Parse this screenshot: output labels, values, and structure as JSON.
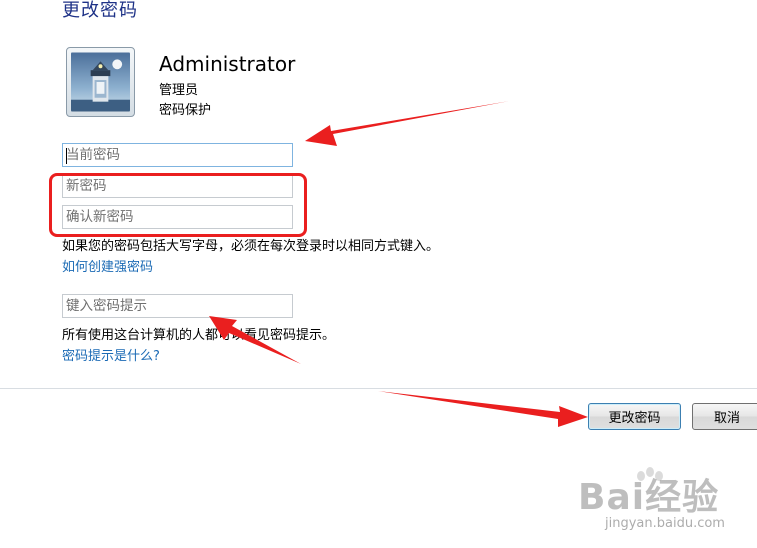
{
  "dialog": {
    "title": "更改密码"
  },
  "account": {
    "name": "Administrator",
    "role": "管理员",
    "protection": "密码保护"
  },
  "fields": {
    "current_password_placeholder": "当前密码",
    "new_password_placeholder": "新密码",
    "confirm_password_placeholder": "确认新密码",
    "hint_placeholder": "键入密码提示"
  },
  "notes": {
    "case_warning": "如果您的密码包括大写字母，必须在每次登录时以相同方式键入。",
    "strong_password_link": "如何创建强密码",
    "hint_visibility": "所有使用这台计算机的人都可以看见密码提示。",
    "hint_help_link": "密码提示是什么?"
  },
  "buttons": {
    "change_password": "更改密码",
    "cancel": "取消"
  },
  "watermark": {
    "brand": "Bai经验",
    "url": "jingyan.baidu.com"
  },
  "colors": {
    "title": "#1e3287",
    "link": "#1c6bb5",
    "annotation": "#ea1f1f"
  }
}
